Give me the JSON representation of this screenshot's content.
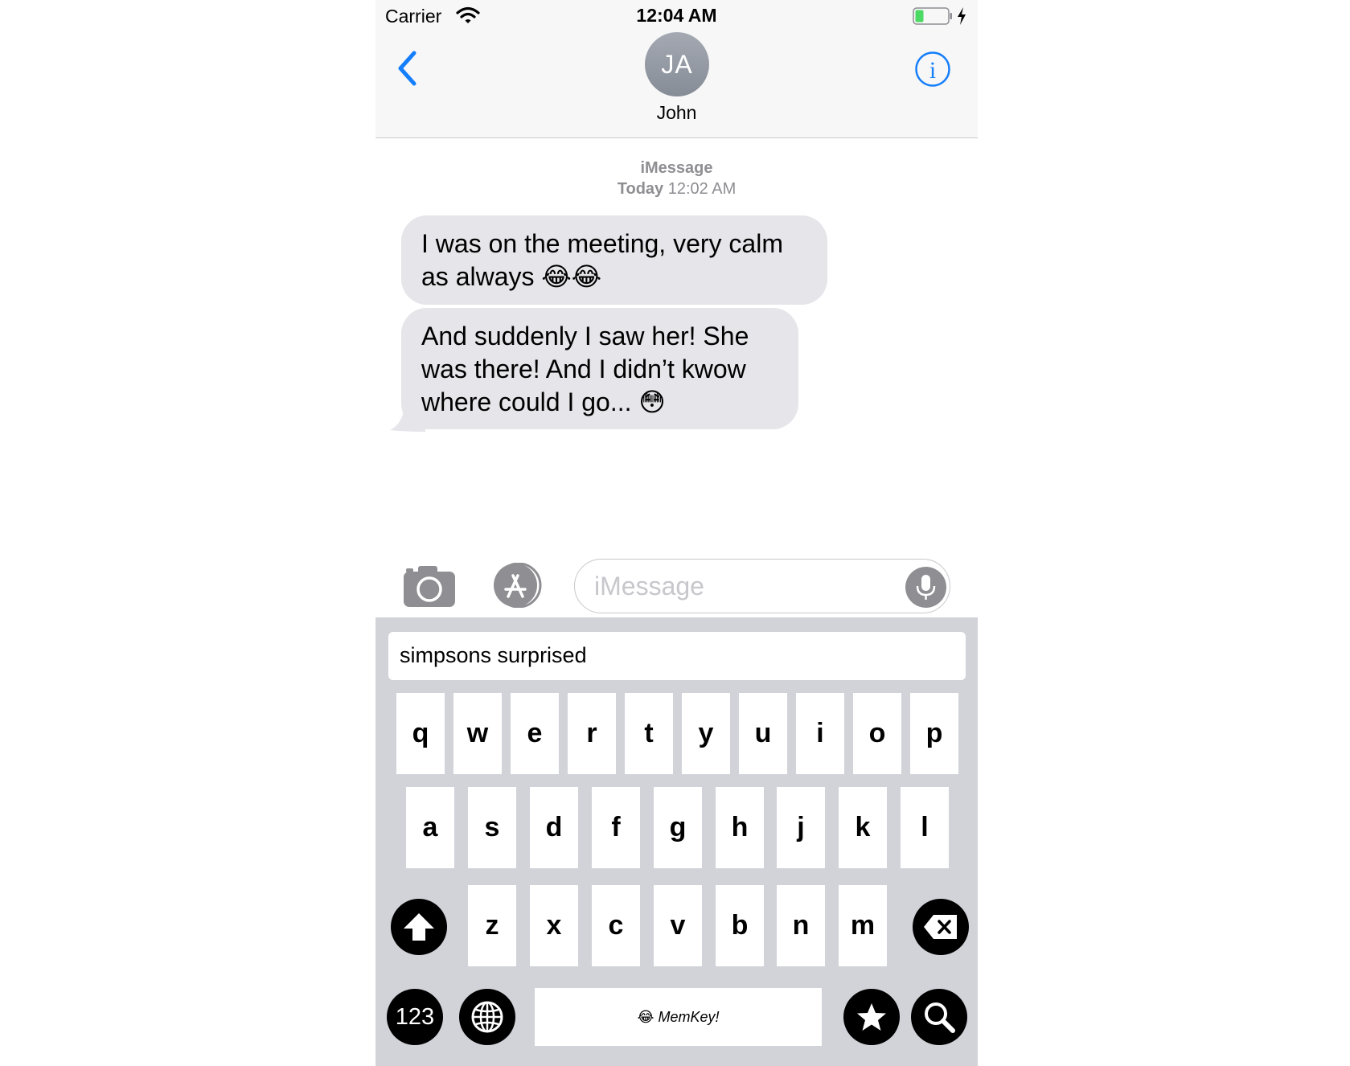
{
  "status_bar": {
    "carrier": "Carrier",
    "time": "12:04 AM"
  },
  "header": {
    "avatar_initials": "JA",
    "contact_name": "John"
  },
  "conversation": {
    "service": "iMessage",
    "timestamp_day": "Today",
    "timestamp_time": "12:02 AM",
    "messages": [
      {
        "line1": "I was on the meeting, very calm",
        "line2": "as always 😂😂"
      },
      {
        "line1": "And suddenly I saw her! She",
        "line2": "was there! And I didn’t kwow",
        "line3": "where could I go...  😳"
      }
    ]
  },
  "compose": {
    "placeholder": "iMessage"
  },
  "keyboard": {
    "search_query": "simpsons surprised",
    "row1": [
      "q",
      "w",
      "e",
      "r",
      "t",
      "y",
      "u",
      "i",
      "o",
      "p"
    ],
    "row2": [
      "a",
      "s",
      "d",
      "f",
      "g",
      "h",
      "j",
      "k",
      "l"
    ],
    "row3": [
      "z",
      "x",
      "c",
      "v",
      "b",
      "n",
      "m"
    ],
    "numbers_label": "123",
    "space_label": "😂 MemKey!"
  },
  "colors": {
    "accent": "#157efb",
    "bubble": "#e5e5ea",
    "keyboard_bg": "#d1d3d9"
  }
}
